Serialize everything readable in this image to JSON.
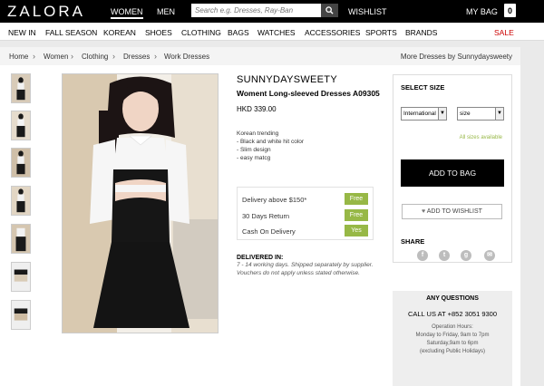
{
  "header": {
    "logo": "ZALORA",
    "nav": [
      "WOMEN",
      "MEN"
    ],
    "search_placeholder": "Search e.g. Dresses, Ray-Ban",
    "wishlist": "WISHLIST",
    "my_bag": "MY BAG",
    "bag_count": "0"
  },
  "categories": [
    "NEW IN",
    "FALL SEASON",
    "KOREAN",
    "SHOES",
    "CLOTHING",
    "BAGS",
    "WATCHES",
    "ACCESSORIES",
    "SPORTS",
    "BRANDS",
    "SALE"
  ],
  "breadcrumb": [
    "Home",
    "Women",
    "Clothing",
    "Dresses",
    "Work Dresses"
  ],
  "more_link": "More Dresses by Sunnydaysweety",
  "product": {
    "brand": "SUNNYDAYSWEETY",
    "name": "Woment Long-sleeved Dresses A09305",
    "price": "HKD 339.00",
    "description": [
      "Korean trending",
      "- Black and white hit color",
      "- Slim design",
      "- easy matcg"
    ]
  },
  "delivery": [
    {
      "label": "Delivery above $150*",
      "badge": "Free"
    },
    {
      "label": "30 Days Return",
      "badge": "Free"
    },
    {
      "label": "Cash On Delivery",
      "badge": "Yes"
    }
  ],
  "delivered_in": {
    "title": "DELIVERED IN:",
    "text": "7 - 14 working days. Shipped separately by supplier. Vouchers do not apply unless stated otherwise."
  },
  "size_panel": {
    "title": "SELECT SIZE",
    "system_value": "International",
    "size_value": "size",
    "availability": "All sizes available",
    "add_to_bag": "ADD TO BAG",
    "add_to_wishlist": "ADD TO WISHLIST",
    "share_title": "SHARE",
    "share_icons": [
      "facebook-icon",
      "twitter-icon",
      "google-plus-icon",
      "email-icon"
    ]
  },
  "questions": {
    "title": "ANY QUESTIONS",
    "call": "CALL US AT +852 3051 9300",
    "hours": [
      "Operation Hours:",
      "Monday to Friday, 9am to 7pm",
      "Saturday,9am to 6pm",
      "(excluding Public Holidays)"
    ]
  },
  "colors": {
    "accent_green": "#97b846",
    "black": "#000000"
  }
}
